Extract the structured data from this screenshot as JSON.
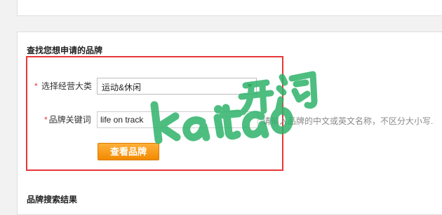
{
  "search_section": {
    "title": "查找您想申请的品牌",
    "required_mark": "*",
    "category_label": "选择经营大类",
    "category_value": "运动&休闲",
    "keyword_label": "品牌关键词",
    "keyword_value": "life on track",
    "hint": "请输入品牌的中文或英文名称，不区分大小写.",
    "search_button": "查看品牌"
  },
  "results_section": {
    "title": "品牌搜索结果"
  },
  "watermark": {
    "text": "kaitao开淘"
  },
  "colors": {
    "highlight_border": "#e8373a",
    "button_orange": "#f59b12",
    "watermark_green": "#2fb36a"
  }
}
